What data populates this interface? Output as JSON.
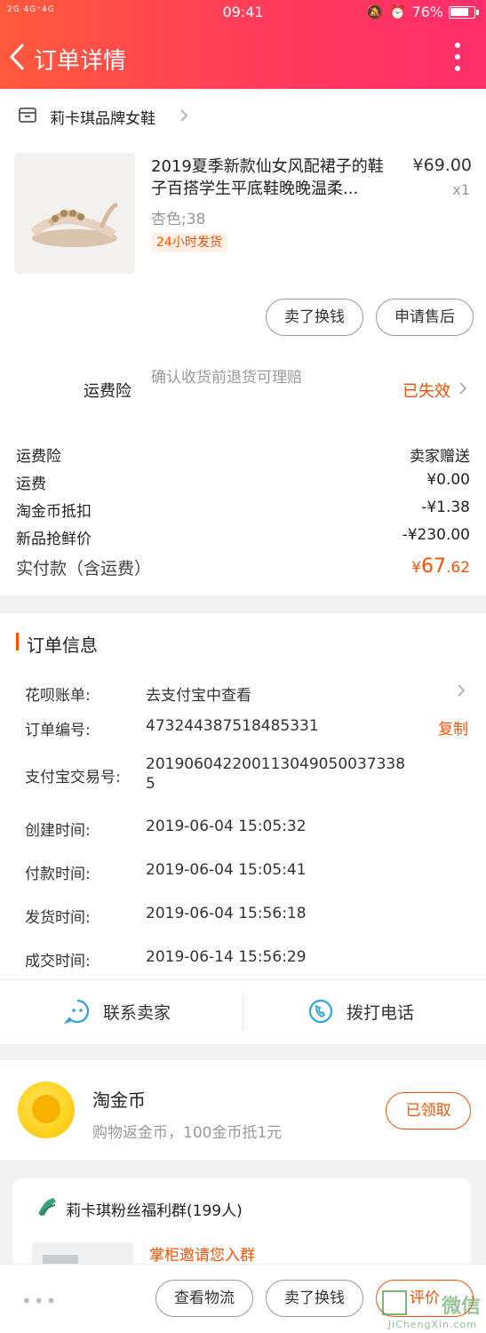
{
  "status": {
    "signal": "2G 4G⁺4G",
    "time": "09:41",
    "battery": "76%"
  },
  "header": {
    "title": "订单详情"
  },
  "shop": {
    "name": "莉卡琪品牌女鞋"
  },
  "product": {
    "title": "2019夏季新款仙女风配裙子的鞋子百搭学生平底鞋晚晚温柔...",
    "price": "¥69.00",
    "qty": "x1",
    "sku": "杏色;38",
    "tag": "24小时发货",
    "buttons": [
      "卖了换钱",
      "申请售后"
    ]
  },
  "insurance": {
    "label": "运费险",
    "desc": "确认收货前退货可理赔",
    "status": "已失效"
  },
  "fees": [
    {
      "label": "运费险",
      "value": "卖家赠送"
    },
    {
      "label": "运费",
      "value": "¥0.00"
    },
    {
      "label": "淘金币抵扣",
      "value": "-¥1.38"
    },
    {
      "label": "新品抢鲜价",
      "value": "-¥230.00"
    }
  ],
  "total": {
    "label": "实付款（含运费）",
    "currency": "¥",
    "int": "67",
    "dec": ".62"
  },
  "order_info": {
    "title": "订单信息",
    "copy": "复制",
    "rows": [
      {
        "label": "花呗账单:",
        "value": "去支付宝中查看"
      },
      {
        "label": "订单编号:",
        "value": "473244387518485331"
      },
      {
        "label": "支付宝交易号:",
        "value": "201906042200113049050037338",
        "value2": "5"
      },
      {
        "label": "创建时间:",
        "value": "2019-06-04 15:05:32"
      },
      {
        "label": "付款时间:",
        "value": "2019-06-04 15:05:41"
      },
      {
        "label": "发货时间:",
        "value": "2019-06-04 15:56:18"
      },
      {
        "label": "成交时间:",
        "value": "2019-06-14 15:56:29"
      }
    ]
  },
  "contact": {
    "seller": "联系卖家",
    "phone": "拨打电话"
  },
  "coin": {
    "title": "淘金币",
    "desc": "购物返金币，100金币抵1元",
    "button": "已领取"
  },
  "group": {
    "name": "莉卡琪粉丝福利群(199人)",
    "invite": "掌柜邀请您入群"
  },
  "bottom": {
    "dots": "•••",
    "buttons": [
      "查看物流",
      "卖了换钱",
      "评价"
    ]
  },
  "watermark": {
    "text": "微信",
    "sub": "JiChengXin.com"
  },
  "colors": {
    "accent": "#ff5000",
    "header_start": "#ff5a3c",
    "header_end": "#ff2d6a"
  }
}
